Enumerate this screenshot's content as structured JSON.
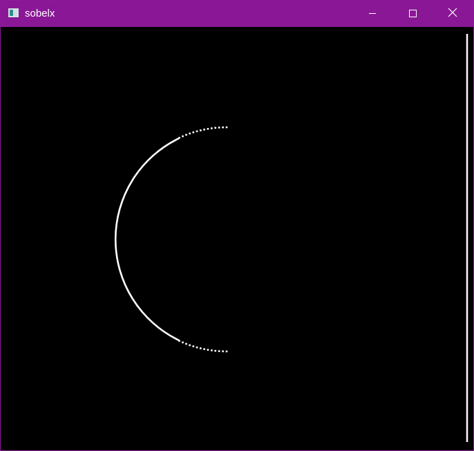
{
  "window": {
    "title": "sobelx",
    "titlebar_color": "#8a1896",
    "icon": "app-window-icon"
  },
  "controls": {
    "minimize_icon": "minimize-icon",
    "maximize_icon": "maximize-icon",
    "close_icon": "close-icon"
  },
  "canvas": {
    "background": "#000000",
    "foreground": "#ffffff",
    "content": "edge-detection-output"
  }
}
